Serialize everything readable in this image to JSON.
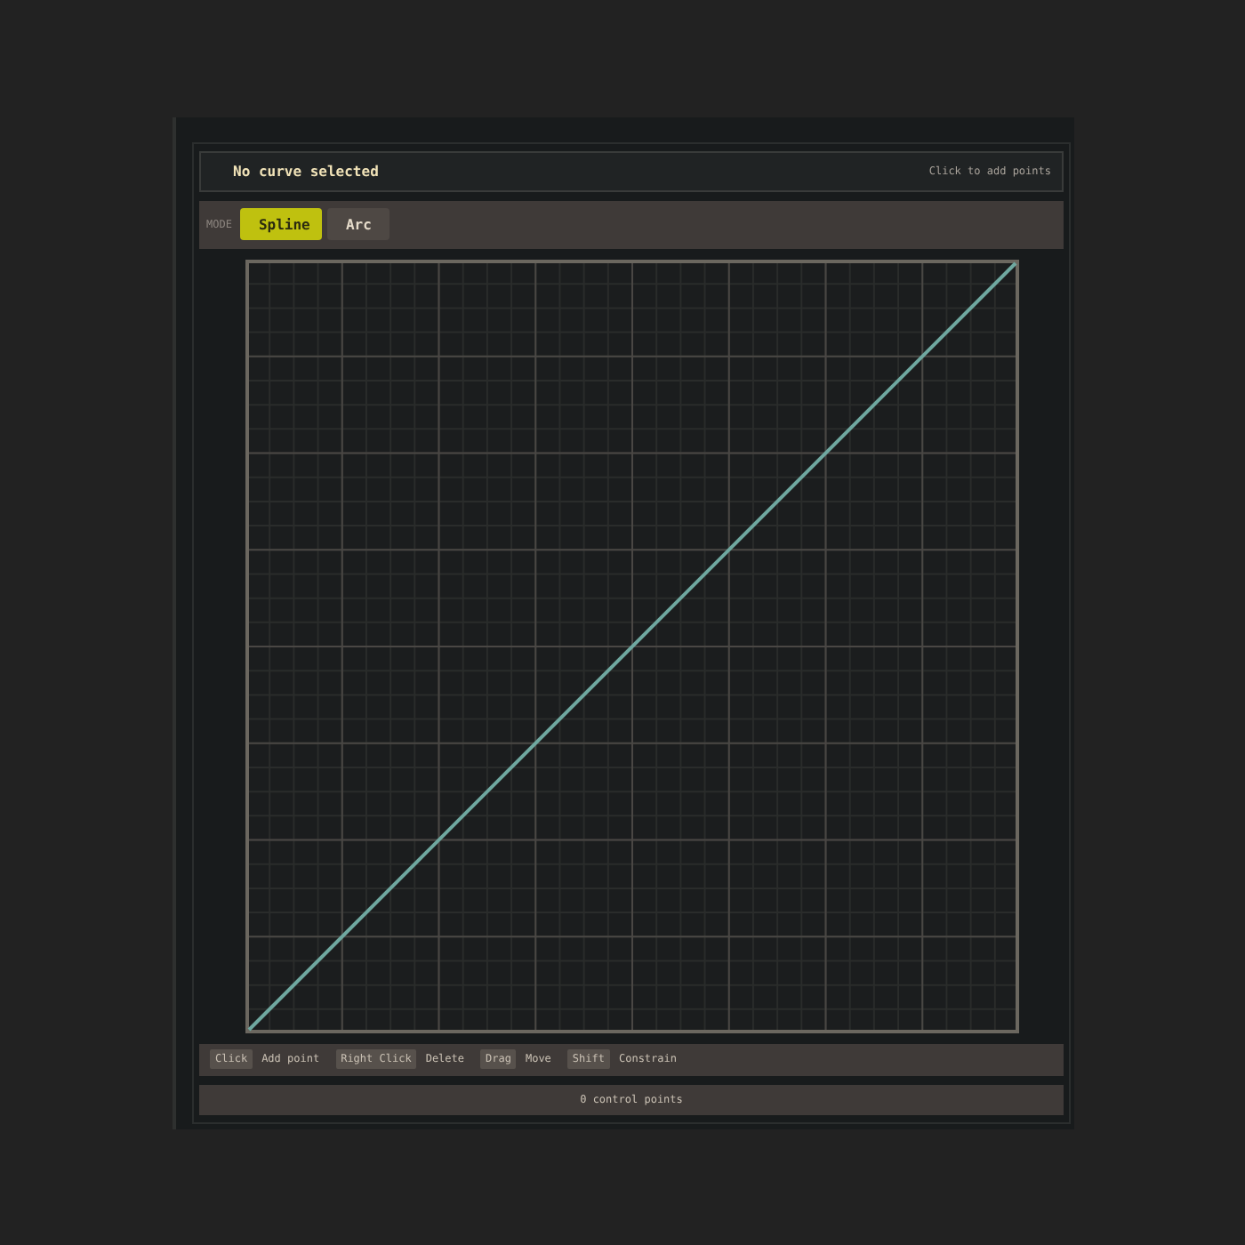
{
  "header": {
    "title": "No curve selected",
    "hint": "Click to add points"
  },
  "mode": {
    "label": "MODE",
    "tabs": [
      {
        "label": "Spline",
        "selected": true
      },
      {
        "label": "Arc",
        "selected": false
      }
    ]
  },
  "shortcuts": [
    {
      "key": "Click",
      "action": "Add point"
    },
    {
      "key": "Right Click",
      "action": "Delete"
    },
    {
      "key": "Drag",
      "action": "Move"
    },
    {
      "key": "Shift",
      "action": "Constrain"
    }
  ],
  "status_bar": "0 control points"
}
